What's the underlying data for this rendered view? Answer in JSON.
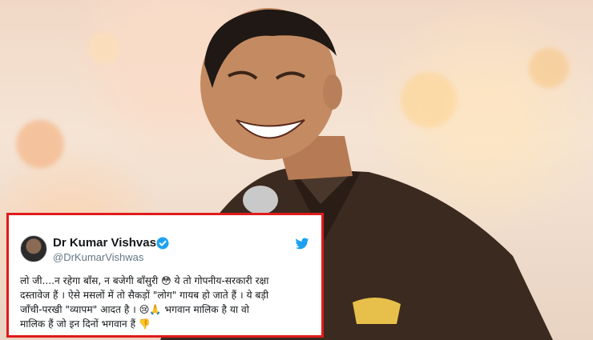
{
  "tweet": {
    "author_name": "Dr Kumar Vishvas",
    "author_handle": "@DrKumarVishwas",
    "lines": [
      "लो जी....न रहेगा बाँस, न बजेगी बाँसुरी 😳 ये तो गोपनीय-सरकारी रक्षा",
      "दस्तावेज हैं । ऐसे मसलों में तो सैकड़ों \"लोग\" गायब हो जाते हैं । ये बड़ी",
      "जाँची-परखी \"व्यापम\" आदत है । 😢🙏 भगवान मालिक है या वो",
      "मालिक हैं जो इन दिनों भगवान हैं 👎"
    ],
    "icons": {
      "verified": "verified-badge-icon",
      "platform": "twitter-bird-icon"
    },
    "colors": {
      "border": "#e01b1b",
      "verified": "#1da1f2",
      "bird": "#1da1f2"
    }
  }
}
